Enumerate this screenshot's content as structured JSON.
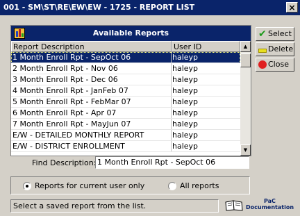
{
  "window": {
    "title": "001 - SM\\ST\\RE\\EW\\EW - 1725 - REPORT LIST",
    "close_glyph": "×"
  },
  "panel": {
    "title": "Available Reports",
    "icon": "chart-icon",
    "columns": [
      "Report Description",
      "User ID"
    ],
    "rows": [
      {
        "description": "1 Month Enroll Rpt - SepOct 06",
        "user": "haleyp",
        "selected": true
      },
      {
        "description": "2 Month Enroll Rpt - Nov 06",
        "user": "haleyp"
      },
      {
        "description": "3 Month Enroll Rpt - Dec 06",
        "user": "haleyp"
      },
      {
        "description": "4 Month Enroll Rpt - JanFeb 07",
        "user": "haleyp"
      },
      {
        "description": "5 Month Enroll Rpt - FebMar 07",
        "user": "haleyp"
      },
      {
        "description": "6 Month Enroll Rpt - Apr 07",
        "user": "haleyp"
      },
      {
        "description": "7 Month Enroll Rpt - MayJun 07",
        "user": "haleyp"
      },
      {
        "description": "E/W - DETAILED MONTHLY REPORT",
        "user": "haleyp"
      },
      {
        "description": "E/W - DISTRICT ENROLLMENT",
        "user": "haleyp"
      }
    ]
  },
  "find": {
    "label": "Find Description:",
    "value": "1 Month Enroll Rpt - SepOct 06"
  },
  "buttons": {
    "select": "Select",
    "delete": "Delete",
    "close": "Close"
  },
  "radios": [
    {
      "label": "Reports for current user only",
      "checked": true
    },
    {
      "label": "All reports",
      "checked": false
    }
  ],
  "status": "Select a saved report from the list.",
  "pac": {
    "line1": "PaC",
    "line2": "Documentation"
  },
  "colors": {
    "title_bar": "#0a246a",
    "selection": "#0a246a",
    "face": "#d4d0c8"
  }
}
